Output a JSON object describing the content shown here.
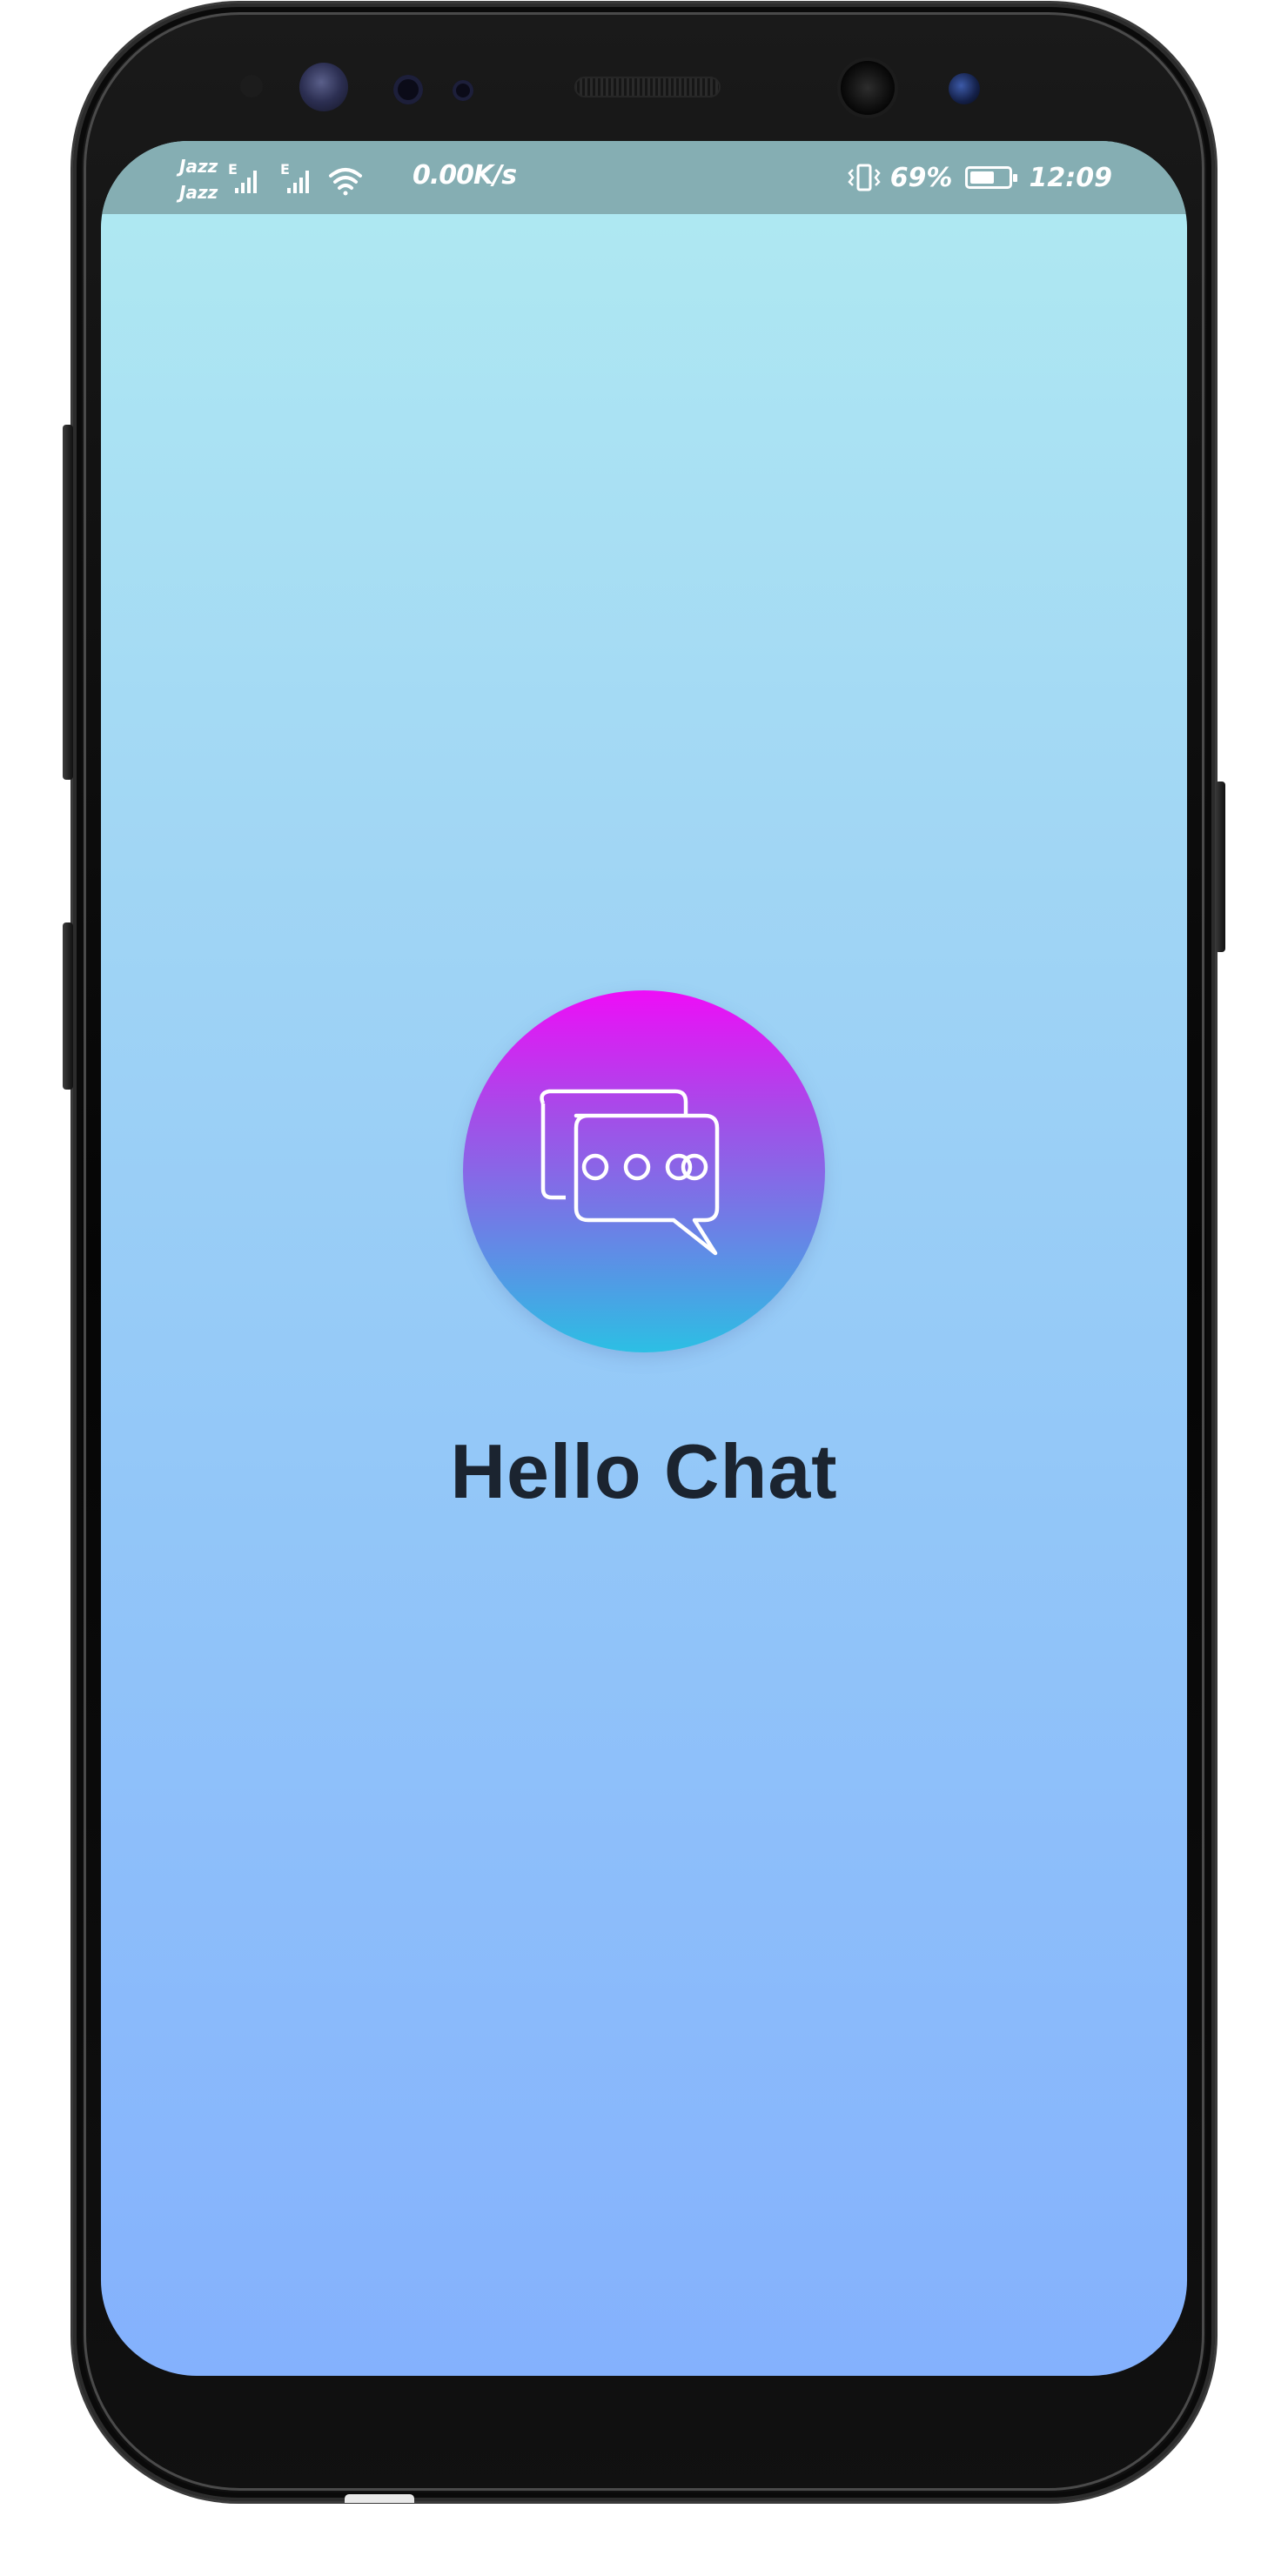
{
  "status_bar": {
    "carrier_1": "Jazz",
    "carrier_2": "Jazz",
    "network_type": "E",
    "net_speed": "0.00K/s",
    "battery_percent": "69%",
    "battery_level": 0.69,
    "time": "12:09",
    "icons": [
      "signal-icon",
      "signal-icon",
      "wifi-icon",
      "vibrate-icon",
      "battery-icon"
    ]
  },
  "app": {
    "title": "Hello Chat",
    "logo_icon": "chat-bubbles-icon"
  },
  "colors": {
    "background_top": "#b0eaf2",
    "background_bottom": "#84b1fd",
    "status_bar": "#85aeb3",
    "logo_top": "#ee0df7",
    "logo_bottom": "#2cbfe4",
    "title_text": "#1b2430"
  }
}
